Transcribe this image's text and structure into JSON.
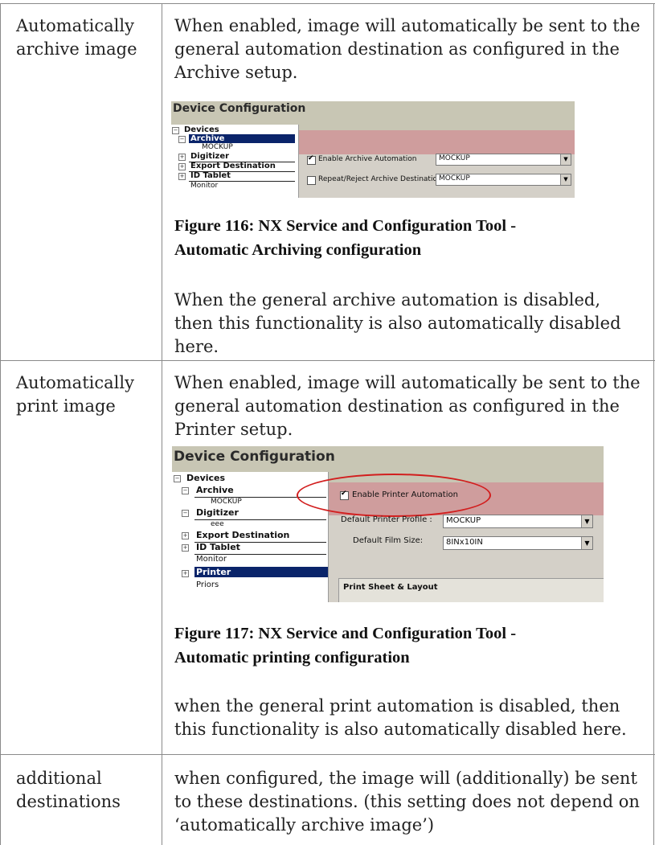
{
  "rows": [
    {
      "label": "Automatically archive image",
      "intro": "When enabled, image will automatically be sent to the general automation destination as configured in the Archive setup.",
      "figure": {
        "title": "Device Configuration",
        "tree": {
          "root": "Devices",
          "archive": "Archive",
          "archive_child": "MOCKUP",
          "digitizer": "Digitizer",
          "export": "Export Destination",
          "idtablet": "ID Tablet",
          "monitor": "Monitor"
        },
        "enable_label": "Enable Archive Automation",
        "enable_checked": true,
        "enable_value": "MOCKUP",
        "repeat_label": "Repeat/Reject Archive Destination",
        "repeat_checked": false,
        "repeat_value": "MOCKUP"
      },
      "caption": "Figure 116: NX Service and Configuration Tool - Automatic Archiving configuration",
      "note": "When the general archive automation is disabled, then this functionality is also automatically disabled here."
    },
    {
      "label": "Automatically print image",
      "intro": "When enabled, image will automatically be sent to the general automation destination as configured in the Printer setup.",
      "figure": {
        "title": "Device Configuration",
        "tree": {
          "root": "Devices",
          "archive": "Archive",
          "archive_child": "MOCKUP",
          "digitizer": "Digitizer",
          "digitizer_child": "eee",
          "export": "Export Destination",
          "idtablet": "ID Tablet",
          "monitor": "Monitor",
          "printer": "Printer",
          "priors": "Priors"
        },
        "enable_label": "Enable Printer Automation",
        "enable_checked": true,
        "profile_label": "Default Printer Profile :",
        "profile_value": "MOCKUP",
        "film_label": "Default Film Size:",
        "film_value": "8INx10IN",
        "section_label": "Print Sheet & Layout"
      },
      "caption": "Figure 117: NX Service and Configuration Tool - Automatic printing configuration",
      "note": "when the general print automation is disabled, then this functionality is also automatically disabled here."
    },
    {
      "label": "additional destinations",
      "intro": "when configured, the image will (additionally) be sent to these destinations. (this setting does not depend on ‘automatically archive image’)"
    }
  ]
}
